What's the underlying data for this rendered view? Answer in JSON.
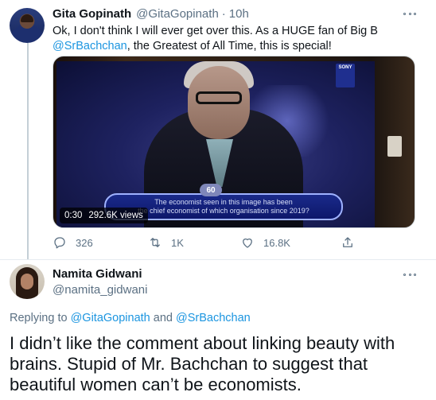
{
  "tweet": {
    "author_name": "Gita Gopinath",
    "author_handle": "@GitaGopinath",
    "separator": "·",
    "time": "10h",
    "text_line1": "Ok, I don't think I will ever get over this. As a HUGE fan of Big B",
    "text_mention": "@SrBachchan",
    "text_line2_rest": ", the Greatest of All Time, this is special!",
    "media": {
      "channel_logo": "SONY",
      "prize_amount": "60",
      "question_line1": "The economist seen in this image has been",
      "question_line2": "the chief economist of which organisation since 2019?",
      "duration": "0:30",
      "views": "292.6K views"
    },
    "actions": {
      "replies": "326",
      "retweets": "1K",
      "likes": "16.8K"
    }
  },
  "reply": {
    "author_name": "Namita Gidwani",
    "author_handle": "@namita_gidwani",
    "replying_prefix": "Replying to ",
    "replying_to_1": "@GitaGopinath",
    "replying_and": " and ",
    "replying_to_2": "@SrBachchan",
    "text": "I didn’t like the comment about linking beauty with brains. Stupid of Mr. Bachchan to suggest that beautiful women can’t be economists."
  },
  "colors": {
    "accent": "#1b95e0",
    "secondary_text": "#5b7083",
    "primary_text": "#0f1419"
  }
}
